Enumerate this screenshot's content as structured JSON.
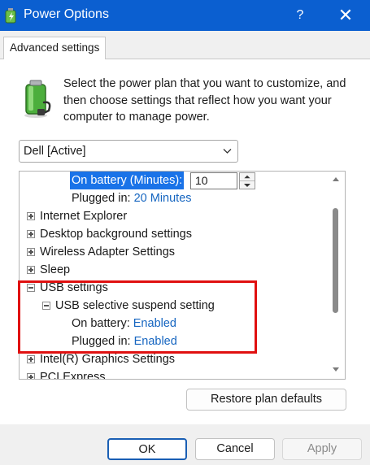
{
  "window": {
    "title": "Power Options",
    "help_label": "?",
    "close_label": "✕",
    "icon": "power-options-icon"
  },
  "tabs": [
    {
      "label": "Advanced settings",
      "active": true
    }
  ],
  "header": {
    "icon": "battery-plug-icon",
    "description": "Select the power plan that you want to customize, and then choose settings that reflect how you want your computer to manage power."
  },
  "plan_select": {
    "value": "Dell [Active]"
  },
  "tree": {
    "rows": [
      {
        "label": "On battery (Minutes):",
        "value": "10",
        "highlighted": true,
        "editable": true
      },
      {
        "label": "Plugged in:",
        "value": "20 Minutes"
      },
      {
        "label": "Internet Explorer",
        "expander": "plus"
      },
      {
        "label": "Desktop background settings",
        "expander": "plus"
      },
      {
        "label": "Wireless Adapter Settings",
        "expander": "plus"
      },
      {
        "label": "Sleep",
        "expander": "plus"
      },
      {
        "label": "USB settings",
        "expander": "minus"
      },
      {
        "label": "USB selective suspend setting",
        "expander": "minus"
      },
      {
        "label": "On battery:",
        "value": "Enabled"
      },
      {
        "label": "Plugged in:",
        "value": "Enabled"
      },
      {
        "label": "Intel(R) Graphics Settings",
        "expander": "plus"
      },
      {
        "label": "PCI Express",
        "expander": "plus"
      }
    ]
  },
  "buttons": {
    "restore": "Restore plan defaults",
    "ok": "OK",
    "cancel": "Cancel",
    "apply": "Apply"
  },
  "colors": {
    "titlebar": "#0b5fd0",
    "highlight": "#1a73e8",
    "link": "#1565c0",
    "annotation": "#e01010"
  }
}
